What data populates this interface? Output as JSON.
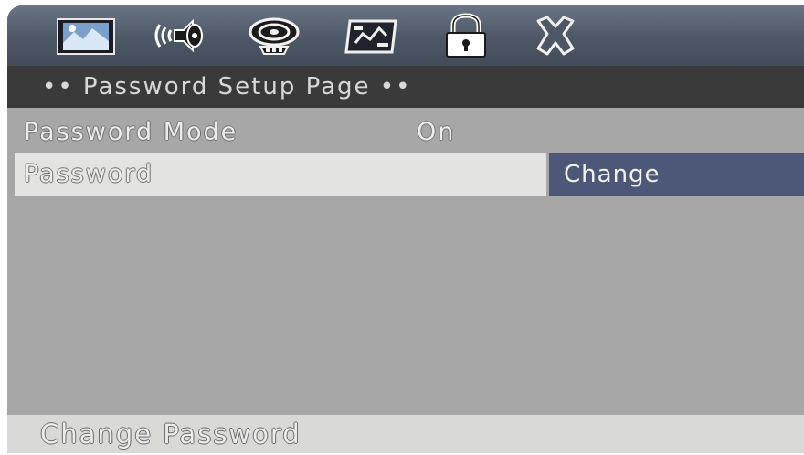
{
  "icon_bar": {
    "tabs": [
      {
        "name": "general-setup",
        "icon": "picture-icon",
        "active": false
      },
      {
        "name": "audio-setup",
        "icon": "speaker-icon",
        "active": false
      },
      {
        "name": "disc-setup",
        "icon": "disc-icon",
        "active": false
      },
      {
        "name": "preference-setup",
        "icon": "preferences-icon",
        "active": false
      },
      {
        "name": "password-setup",
        "icon": "lock-icon",
        "active": true
      },
      {
        "name": "exit",
        "icon": "close-icon",
        "active": false
      }
    ]
  },
  "header": {
    "title": "•• Password Setup Page ••"
  },
  "menu": {
    "items": [
      {
        "label": "Password Mode",
        "value": "On"
      },
      {
        "label": "Password",
        "value": "",
        "highlighted": true
      }
    ],
    "submenu_option": "Change"
  },
  "status": {
    "text": "Change Password"
  },
  "colors": {
    "selected_option_bg": "#4d5878",
    "highlight_row_bg": "#e3e3e1",
    "header_bg": "#3a3a3a",
    "body_bg": "#a7a7a7"
  }
}
